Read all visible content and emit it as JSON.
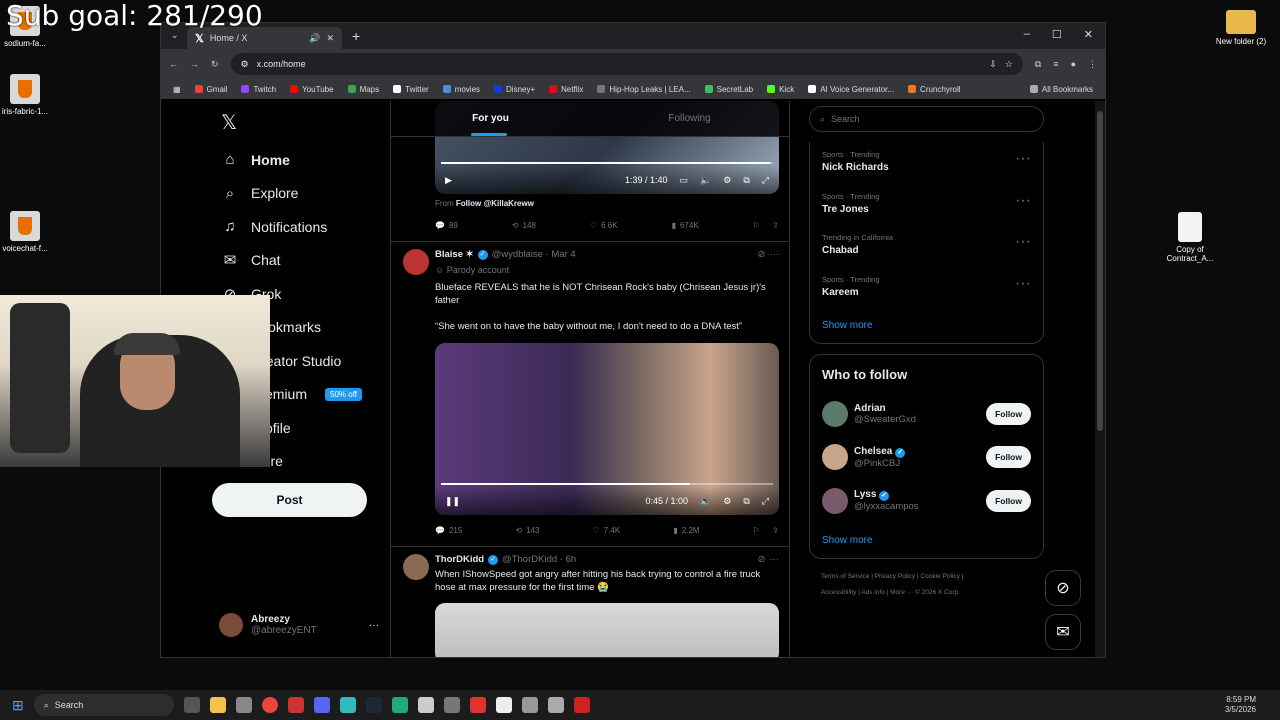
{
  "overlay": {
    "sub_goal": "Sub goal: 281/290"
  },
  "desktop": {
    "icons": [
      {
        "label": "sodium-fa..."
      },
      {
        "label": "iris-fabric-1..."
      },
      {
        "label": "voicechat-f..."
      },
      {
        "label": "New folder (2)"
      },
      {
        "label": "Copy of Contract_A..."
      }
    ]
  },
  "browser": {
    "tab_title": "Home / X",
    "url": "x.com/home",
    "bookmarks": [
      "Gmail",
      "Twitch",
      "YouTube",
      "Maps",
      "Twitter",
      "movies",
      "Disney+",
      "Netflix",
      "Hip-Hop Leaks | LEA...",
      "SecretLab",
      "Kick",
      "AI Voice Generator...",
      "Crunchyroll"
    ],
    "all_bookmarks": "All Bookmarks"
  },
  "nav": {
    "items": [
      {
        "label": "Home"
      },
      {
        "label": "Explore"
      },
      {
        "label": "Notifications"
      },
      {
        "label": "Chat"
      },
      {
        "label": "Grok"
      },
      {
        "label": "Bookmarks"
      },
      {
        "label": "Creator Studio"
      },
      {
        "label": "Premium"
      },
      {
        "label": "Profile"
      },
      {
        "label": "More"
      }
    ],
    "premium_badge": "50% off",
    "post_button": "Post",
    "account_name": "Abreezy",
    "account_handle": "@abreezyENT"
  },
  "timeline": {
    "tab_for_you": "For you",
    "tab_following": "Following",
    "post0": {
      "video_time": "1:39 / 1:40",
      "progress": 0.99,
      "follow_prefix": "From",
      "follow_text": "Follow @KillaKreww",
      "replies": "89",
      "reposts": "148",
      "likes": "6.6K",
      "views": "674K"
    },
    "post1": {
      "name": "Blaise ✶",
      "handle": "@wydblaise · Mar 4",
      "label": "Parody account",
      "text1": "Blueface REVEALS that he is NOT Chrisean Rock's baby (Chrisean Jesus jr)'s  father",
      "text2": "“She went on to have the baby without me, I don't need to do a DNA test”",
      "video_time": "0:45 / 1:00",
      "progress": 0.75,
      "replies": "215",
      "reposts": "143",
      "likes": "7.4K",
      "views": "2.2M"
    },
    "post2": {
      "name": "ThorDKidd",
      "handle": "@ThorDKidd · 6h",
      "text": "When IShowSpeed got angry after hitting his back trying to control a fire truck hose at max pressure for the first time 😭"
    }
  },
  "right": {
    "search_placeholder": "Search",
    "trends": [
      {
        "context": "Sports · Trending",
        "name": "Nick Richards"
      },
      {
        "context": "Sports · Trending",
        "name": "Tre Jones"
      },
      {
        "context": "Trending in California",
        "name": "Chabad"
      },
      {
        "context": "Sports · Trending",
        "name": "Kareem"
      }
    ],
    "show_more": "Show more",
    "who_title": "Who to follow",
    "who": [
      {
        "name": "Adrian",
        "handle": "@SweaterGxd",
        "verified": false
      },
      {
        "name": "Chelsea",
        "handle": "@PinkCBJ",
        "verified": true
      },
      {
        "name": "Lyss",
        "handle": "@lyxxacampos",
        "verified": true
      }
    ],
    "follow_label": "Follow",
    "footer_line1": "Terms of Service  |  Privacy Policy  |  Cookie Policy  |",
    "footer_line2": "Accessibility  |  Ads info  |  More ···  © 2026 X Corp."
  },
  "taskbar": {
    "search": "Search",
    "time": "8:59 PM",
    "date": "3/5/2026"
  }
}
